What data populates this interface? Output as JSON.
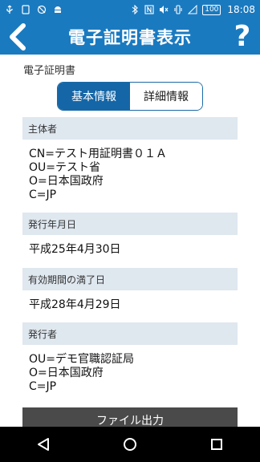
{
  "status_bar": {
    "battery": "100",
    "time": "18:08"
  },
  "header": {
    "title": "電子証明書表示",
    "help_label": "?"
  },
  "page": {
    "section_title": "電子証明書",
    "tabs": [
      {
        "label": "基本情報",
        "active": true
      },
      {
        "label": "詳細情報",
        "active": false
      }
    ],
    "fields": [
      {
        "label": "主体者",
        "lines": [
          "CN=テスト用証明書０１Ａ",
          "OU=テスト省",
          "O=日本国政府",
          "C=JP"
        ]
      },
      {
        "label": "発行年月日",
        "lines": [
          "平成25年4月30日"
        ]
      },
      {
        "label": "有効期間の満了日",
        "lines": [
          "平成28年4月29日"
        ]
      },
      {
        "label": "発行者",
        "lines": [
          "OU=デモ官職認証局",
          "O=日本国政府",
          "C=JP"
        ]
      }
    ],
    "file_button_label": "ファイル出力"
  },
  "colors": {
    "header_bg": "#1a7ac0",
    "tab_active": "#1566a6",
    "field_head_bg": "#dfe7ef",
    "file_button_bg": "#4a4a4a"
  }
}
